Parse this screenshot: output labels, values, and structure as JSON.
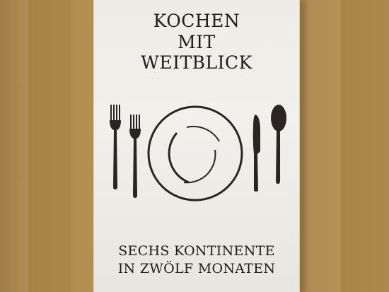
{
  "cover": {
    "title_lines": [
      "KOCHEN",
      "MIT",
      "WEITBLICK"
    ],
    "subtitle_lines": [
      "SECHS KONTINENTE",
      "IN ZWÖLF MONATEN"
    ]
  },
  "illustration": {
    "icons": [
      "fork-icon",
      "fork-icon",
      "plate-icon",
      "knife-icon",
      "spoon-icon"
    ]
  },
  "colors": {
    "ink": "#1f1c1a",
    "board": "#efede8",
    "wood": "#ad8a4f"
  }
}
